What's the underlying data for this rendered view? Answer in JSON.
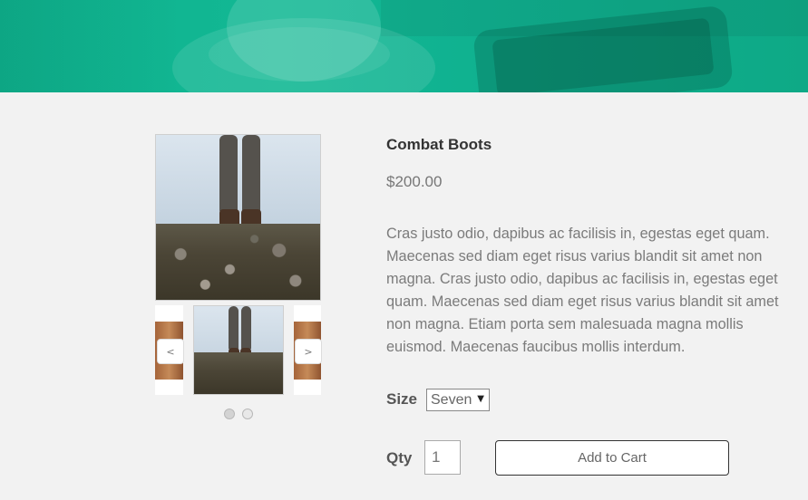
{
  "product": {
    "title": "Combat Boots",
    "price": "$200.00",
    "description": "Cras justo odio, dapibus ac facilisis in, egestas eget quam. Maecenas sed diam eget risus varius blandit sit amet non magna. Cras justo odio, dapibus ac facilisis in, egestas eget quam. Maecenas sed diam eget risus varius blandit sit amet non magna. Etiam porta sem malesuada magna mollis euismod. Maecenas faucibus mollis interdum."
  },
  "gallery": {
    "prev_label": "<",
    "next_label": ">",
    "dots_count": 2,
    "active_dot": 0
  },
  "options": {
    "size_label": "Size",
    "size_value": "Seven",
    "qty_label": "Qty",
    "qty_value": "1"
  },
  "actions": {
    "add_to_cart_label": "Add to Cart"
  },
  "colors": {
    "hero_accent": "#12b894",
    "background": "#f2f2f2"
  }
}
